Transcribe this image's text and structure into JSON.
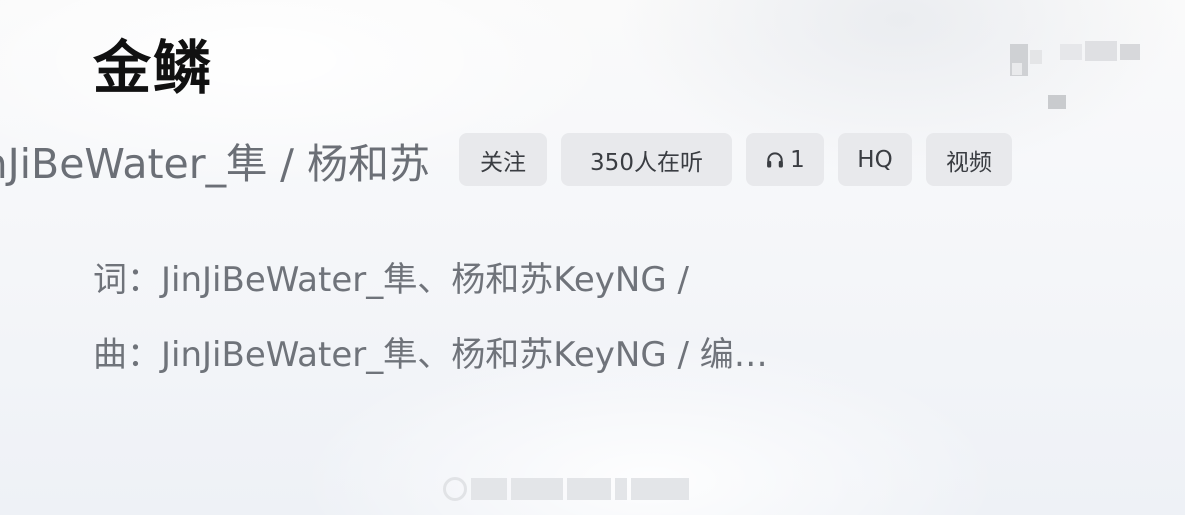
{
  "song": {
    "title": "金鳞",
    "artists_line": "JinJiBeWater_隼 / 杨和苏"
  },
  "tags": {
    "follow": "关注",
    "listeners": "350人在听",
    "headphone_count": "1",
    "quality": "HQ",
    "video": "视频"
  },
  "credits": {
    "lyrics": "词：JinJiBeWater_隼、杨和苏KeyNG /",
    "music": "曲：JinJiBeWater_隼、杨和苏KeyNG / 编…"
  }
}
